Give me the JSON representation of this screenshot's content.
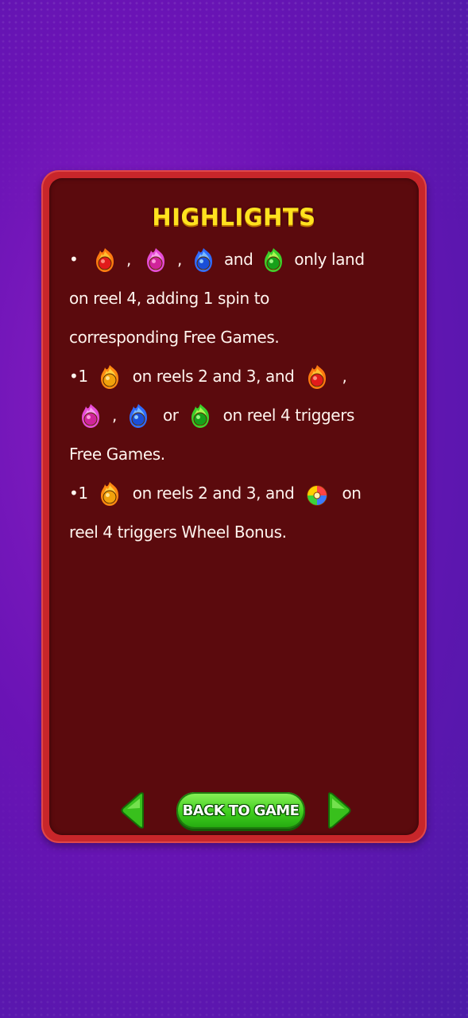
{
  "title": "HIGHLIGHTS",
  "colors": {
    "panel_border": "#c8262a",
    "panel_fill": "#5b0a0d",
    "title": "#ffe21f",
    "button": "#3fce1e",
    "background": "#6a13b5"
  },
  "icons": {
    "red": "red-flame-gem-icon",
    "pink": "pink-flame-gem-icon",
    "blue": "blue-flame-gem-icon",
    "green": "green-flame-gem-icon",
    "gold": "gold-flame-coin-icon",
    "wheel": "wheel-bonus-icon"
  },
  "text": {
    "bullet_dot": "•",
    "comma1": ",",
    "comma2": ",",
    "and1": "and",
    "only_land": "only land",
    "line2": "on reel 4, adding 1 spin to",
    "line3": "corresponding Free Games.",
    "b2_prefix": "•1",
    "b2_reels": "on reels 2 and 3, and",
    "b2_comma1": ",",
    "b2_comma2": ",",
    "b2_or": "or",
    "b2_on_reel4": "on reel 4 triggers",
    "b2_end": "Free Games.",
    "b3_prefix": "•1",
    "b3_reels": "on reels 2 and 3, and",
    "b3_on": "on",
    "b3_end": "reel 4 triggers Wheel Bonus."
  },
  "nav": {
    "back_label": "BACK TO GAME"
  }
}
